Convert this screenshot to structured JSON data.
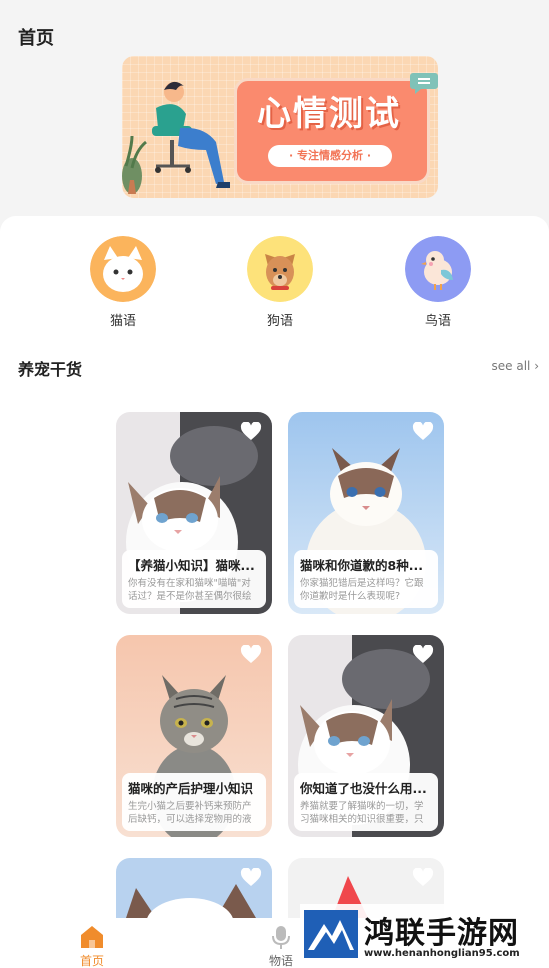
{
  "header": {
    "title": "首页"
  },
  "banner": {
    "title": "心情测试",
    "subtitle": "· 专注情感分析 ·",
    "accent": "#fa8a6e",
    "bg": "#fbd7b3"
  },
  "categories": [
    {
      "label": "猫语",
      "icon": "cat-face-icon",
      "color": "#fbb45c"
    },
    {
      "label": "狗语",
      "icon": "dog-face-icon",
      "color": "#fde27a"
    },
    {
      "label": "鸟语",
      "icon": "bird-icon",
      "color": "#8d9bf3"
    }
  ],
  "section": {
    "title": "养宠干货",
    "see_all": "see all ›"
  },
  "cards": [
    {
      "title": "【养猫小知识】猫咪...",
      "desc": "你有没有在家和猫咪\"喵喵\"对话过？是不是你甚至偶尔很绘画...",
      "liked": false
    },
    {
      "title": "猫咪和你道歉的8种...",
      "desc": "你家猫犯错后是这样吗？它跟你道歉时是什么表现呢?",
      "liked": false
    },
    {
      "title": "猫咪的产后护理小知识",
      "desc": "生完小猫之后要补钙来预防产后缺钙，可以选择宠物用的液体...",
      "liked": false
    },
    {
      "title": "你知道了也没什么用...",
      "desc": "养猫就要了解猫咪的一切，学习猫咪相关的知识很重要，只有...",
      "liked": false
    }
  ],
  "tabbar": {
    "tabs": [
      {
        "label": "首页",
        "active": true
      },
      {
        "label": "物语",
        "active": false
      }
    ],
    "active_color": "#f08c2c"
  },
  "watermark": {
    "text": "鸿联手游网",
    "url": "www.henanhonglian95.com"
  }
}
